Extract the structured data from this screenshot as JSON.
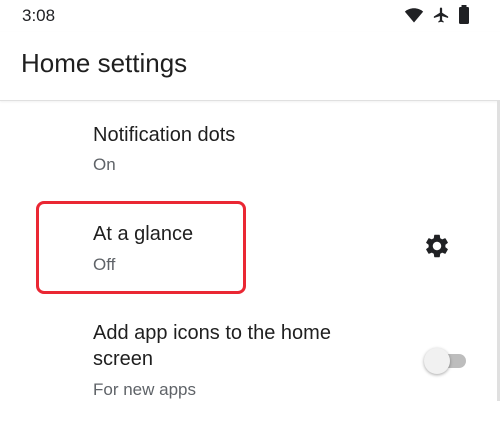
{
  "status_bar": {
    "time": "3:08",
    "icons": [
      "wifi-icon",
      "airplane-icon",
      "battery-icon"
    ]
  },
  "header": {
    "title": "Home settings"
  },
  "settings": [
    {
      "title": "Notification dots",
      "summary": "On"
    },
    {
      "title": "At a glance",
      "summary": "Off",
      "trailing": "gear-icon"
    },
    {
      "title": "Add app icons to the home screen",
      "title_line1": "Add app icons to the home",
      "title_line2": "screen",
      "summary": "For new apps",
      "trailing": "toggle",
      "toggle_on": false
    }
  ],
  "colors": {
    "highlight": "#ea2733",
    "text_primary": "#1f1f1f",
    "text_secondary": "#5f6368"
  }
}
